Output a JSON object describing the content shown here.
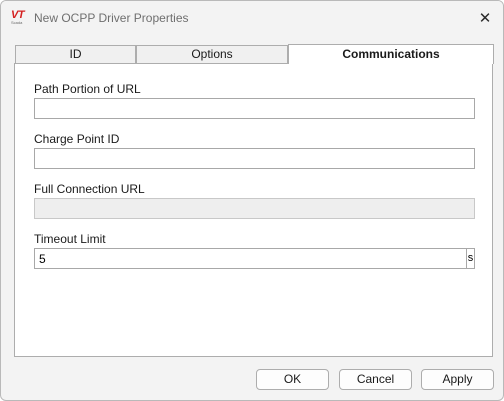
{
  "window": {
    "title": "New OCPP Driver Properties"
  },
  "logo": {
    "mark": "VT",
    "sub": "Scada"
  },
  "icons": {
    "close": "close-icon",
    "app": "vt-scada-logo-icon"
  },
  "tabs": [
    {
      "label": "ID",
      "active": false
    },
    {
      "label": "Options",
      "active": false
    },
    {
      "label": "Communications",
      "active": true
    }
  ],
  "fields": {
    "path_portion": {
      "label": "Path Portion of URL",
      "value": ""
    },
    "charge_point_id": {
      "label": "Charge Point ID",
      "value": ""
    },
    "full_url": {
      "label": "Full Connection URL",
      "value": "",
      "disabled": true
    },
    "timeout": {
      "label": "Timeout Limit",
      "value": "5",
      "unit": "s"
    }
  },
  "buttons": {
    "ok": "OK",
    "cancel": "Cancel",
    "apply": "Apply"
  },
  "colors": {
    "logo_red": "#d42020",
    "window_bg": "#f3f3f3"
  }
}
